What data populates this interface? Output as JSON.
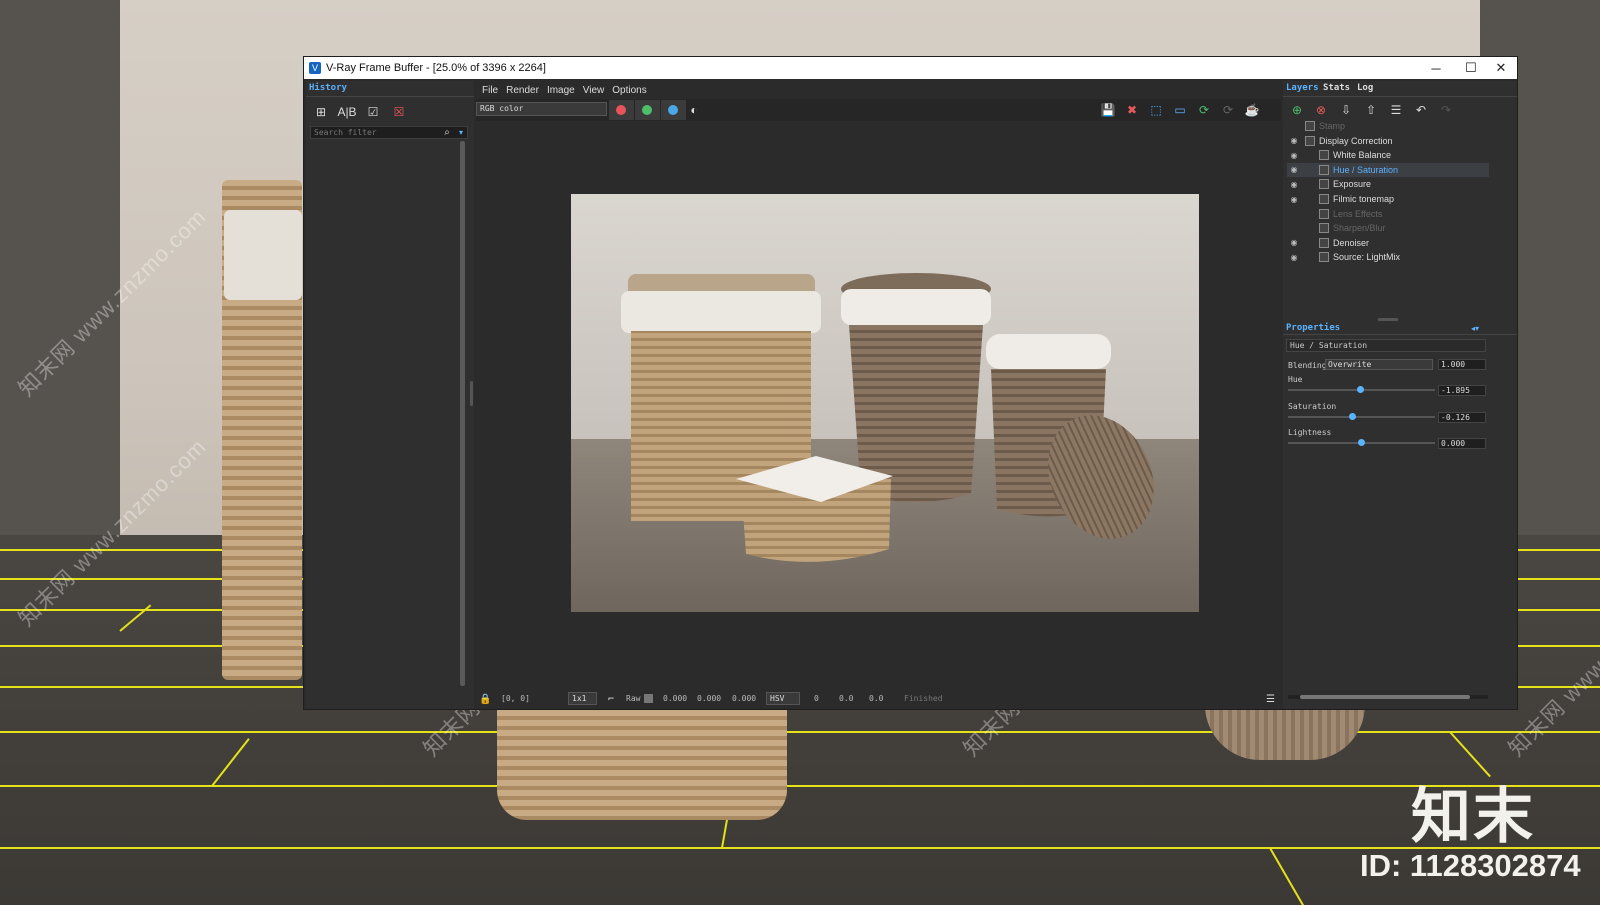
{
  "window": {
    "title": "V-Ray Frame Buffer - [25.0% of 3396 x 2264]",
    "minimize": "─",
    "maximize": "☐",
    "close": "✕"
  },
  "history": {
    "tab": "History",
    "search_placeholder": "Search filter"
  },
  "menu": [
    "File",
    "Render",
    "Image",
    "View",
    "Options"
  ],
  "toolbar": {
    "channel": "RGB color",
    "colors": {
      "red": "#e8545a",
      "green": "#4cbf6a",
      "blue": "#4aa7e8"
    }
  },
  "status": {
    "coords": "[0, 0]",
    "zoom": "1x1",
    "raw": "Raw",
    "rgb": [
      "0.000",
      "0.000",
      "0.000"
    ],
    "mode": "HSV",
    "hsv": [
      "0",
      "0.0",
      "0.0"
    ],
    "state": "Finished"
  },
  "right": {
    "tabs": [
      "Layers",
      "Stats",
      "Log"
    ],
    "layers": [
      {
        "name": "Stamp",
        "state": "off"
      },
      {
        "name": "Display Correction",
        "state": "on"
      },
      {
        "name": "White Balance",
        "state": "on"
      },
      {
        "name": "Hue / Saturation",
        "state": "selected"
      },
      {
        "name": "Exposure",
        "state": "on"
      },
      {
        "name": "Filmic tonemap",
        "state": "on"
      },
      {
        "name": "Lens Effects",
        "state": "off"
      },
      {
        "name": "Sharpen/Blur",
        "state": "off"
      },
      {
        "name": "Denoiser",
        "state": "on"
      },
      {
        "name": "Source: LightMix",
        "state": "on"
      }
    ],
    "properties": {
      "tab": "Properties",
      "layer_name": "Hue / Saturation",
      "blending_label": "Blending",
      "blending_mode": "Overwrite",
      "blending_value": "1.000",
      "hue_label": "Hue",
      "hue_value": "-1.895",
      "hue_level": 0.49,
      "saturation_label": "Saturation",
      "saturation_value": "-0.126",
      "saturation_level": 0.44,
      "lightness_label": "Lightness",
      "lightness_value": "0.000",
      "lightness_level": 0.5
    }
  },
  "watermark": {
    "text": "知末网 www.znzmo.com",
    "logo": "知末",
    "id": "ID: 1128302874"
  }
}
